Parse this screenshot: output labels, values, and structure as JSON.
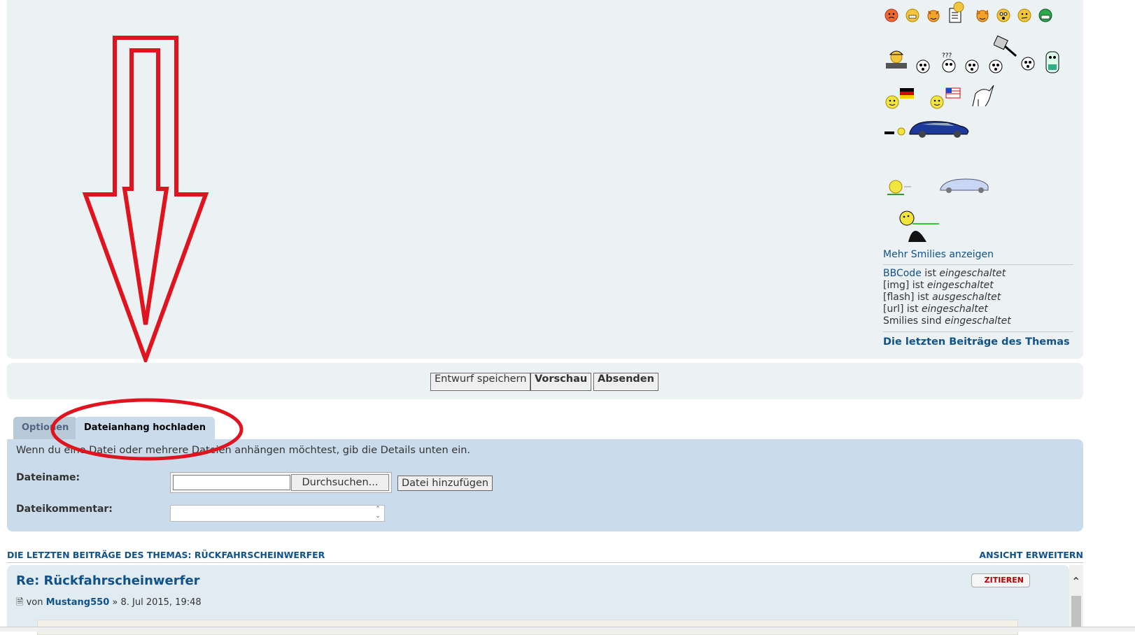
{
  "smilies": {
    "more_link": "Mehr Smilies anzeigen"
  },
  "status": {
    "bbcode_link": "BBCode",
    "bbcode_mid": " ist ",
    "bbcode_state": "eingeschaltet",
    "img_label": "[img] ist ",
    "img_state": "eingeschaltet",
    "flash_label": "[flash] ist ",
    "flash_state": "ausgeschaltet",
    "url_label": "[url] ist ",
    "url_state": "eingeschaltet",
    "smilies_label": "Smilies sind ",
    "smilies_state": "eingeschaltet",
    "latest_posts_link": "Die letzten Beiträge des Themas"
  },
  "buttons": {
    "save_draft": "Entwurf speichern",
    "preview": "Vorschau",
    "submit": "Absenden"
  },
  "tabs": {
    "options": "Optionen",
    "upload": "Dateianhang hochladen"
  },
  "upload": {
    "intro": "Wenn du eine Datei oder mehrere Dateien anhängen möchtest, gib die Details unten ein.",
    "filename_label": "Dateiname:",
    "browse": "Durchsuchen...",
    "add_file": "Datei hinzufügen",
    "comment_label": "Dateikommentar:"
  },
  "review": {
    "section_title": "DIE LETZTEN BEITRÄGE DES THEMAS: RÜCKFAHRSCHEINWERFER",
    "expand_view": "ANSICHT ERWEITERN",
    "post_title": "Re: Rückfahrscheinwerfer",
    "by": "von",
    "author": "Mustang550",
    "date": "» 8. Jul 2015, 19:48",
    "quote": "ZITIEREN"
  },
  "colors": {
    "link": "#105289",
    "panel": "#ecf1f3",
    "upload_panel": "#cadceb",
    "annotation_red": "#e0141e"
  }
}
